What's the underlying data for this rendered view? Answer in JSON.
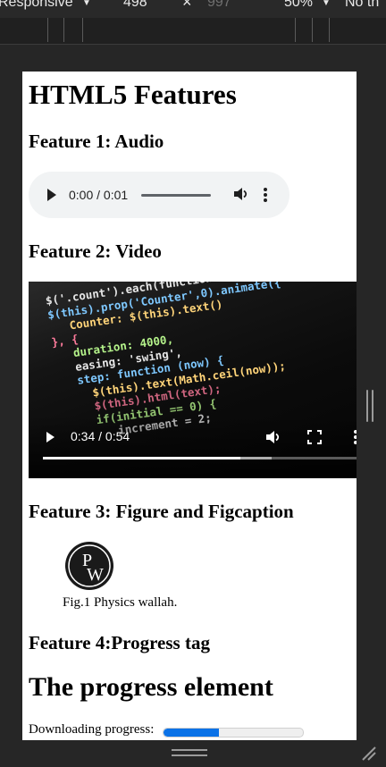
{
  "devtools": {
    "device_mode": "Responsive",
    "width": "498",
    "height": "997",
    "zoom": "50%",
    "throttling": "No th"
  },
  "page": {
    "title": "HTML5 Features",
    "features": {
      "audio_heading": "Feature 1: Audio",
      "video_heading": "Feature 2: Video",
      "figure_heading": "Feature 3: Figure and Figcaption",
      "progress_heading": "Feature 4:Progress tag"
    },
    "audio": {
      "time": "0:00 / 0:01"
    },
    "video": {
      "time": "0:34 / 0:54",
      "progress_fraction": 0.63,
      "buffered_fraction": 0.73,
      "code_lines": [
        "$('.count').each(function () {",
        "$(this).prop('Counter',0).animate({",
        "   Counter: $(this).text()",
        "}, {",
        "   duration: 4000,",
        "   easing: 'swing',",
        "   step: function (now) {",
        "     $(this).text(Math.ceil(now));",
        "     $(this).html(text);",
        "     if(initial == 0) {",
        "        increment = 2;"
      ]
    },
    "figure": {
      "caption": "Fig.1 Physics wallah."
    },
    "progress": {
      "heading": "The progress element",
      "label": "Downloading progress:",
      "value_fraction": 0.4
    }
  },
  "colors": {
    "accent": "#0b72e7",
    "devtools_bg": "#292929",
    "audio_bg": "#f1f3f4"
  }
}
